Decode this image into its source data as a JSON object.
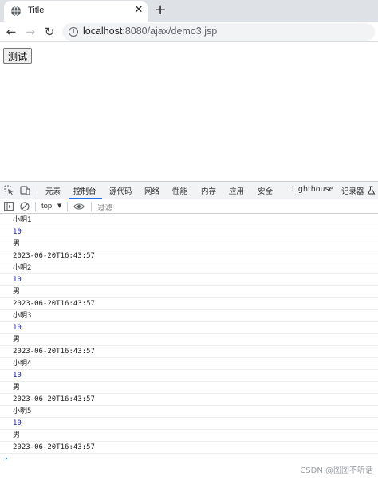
{
  "browser": {
    "tab_title": "Title",
    "close_glyph": "✕",
    "new_tab_glyph": "+",
    "url_host": "localhost",
    "url_rest": ":8080/ajax/demo3.jsp",
    "back_glyph": "←",
    "forward_glyph": "→",
    "reload_glyph": "↻",
    "info_glyph": "i"
  },
  "page": {
    "test_button_label": "测试"
  },
  "devtools": {
    "tabs": [
      {
        "label": "元素"
      },
      {
        "label": "控制台"
      },
      {
        "label": "源代码"
      },
      {
        "label": "网络"
      },
      {
        "label": "性能"
      },
      {
        "label": "内存"
      },
      {
        "label": "应用"
      },
      {
        "label": "安全"
      },
      {
        "label": "Lighthouse"
      },
      {
        "label": "记录器"
      }
    ],
    "active_tab": "控制台",
    "context": "top",
    "filter_placeholder": "过滤",
    "console_lines": [
      {
        "text": "小明1",
        "kind": "string"
      },
      {
        "text": "10",
        "kind": "number"
      },
      {
        "text": "男",
        "kind": "string"
      },
      {
        "text": "2023-06-20T16:43:57",
        "kind": "string"
      },
      {
        "text": "小明2",
        "kind": "string"
      },
      {
        "text": "10",
        "kind": "number"
      },
      {
        "text": "男",
        "kind": "string"
      },
      {
        "text": "2023-06-20T16:43:57",
        "kind": "string"
      },
      {
        "text": "小明3",
        "kind": "string"
      },
      {
        "text": "10",
        "kind": "number"
      },
      {
        "text": "男",
        "kind": "string"
      },
      {
        "text": "2023-06-20T16:43:57",
        "kind": "string"
      },
      {
        "text": "小明4",
        "kind": "string"
      },
      {
        "text": "10",
        "kind": "number"
      },
      {
        "text": "男",
        "kind": "string"
      },
      {
        "text": "2023-06-20T16:43:57",
        "kind": "string"
      },
      {
        "text": "小明5",
        "kind": "string"
      },
      {
        "text": "10",
        "kind": "number"
      },
      {
        "text": "男",
        "kind": "string"
      },
      {
        "text": "2023-06-20T16:43:57",
        "kind": "string"
      }
    ],
    "prompt_glyph": "›"
  },
  "watermark": "CSDN @图图不听话",
  "icons": {
    "favicon": "globe-icon",
    "inspect": "inspect-element-icon",
    "device": "device-toolbar-icon",
    "sidebar": "sidebar-toggle-icon",
    "clear": "clear-console-icon",
    "eye": "live-expression-icon",
    "recorder": "flask-icon"
  },
  "colors": {
    "accent": "#1a73e8",
    "number_value": "#1a1aa6"
  }
}
